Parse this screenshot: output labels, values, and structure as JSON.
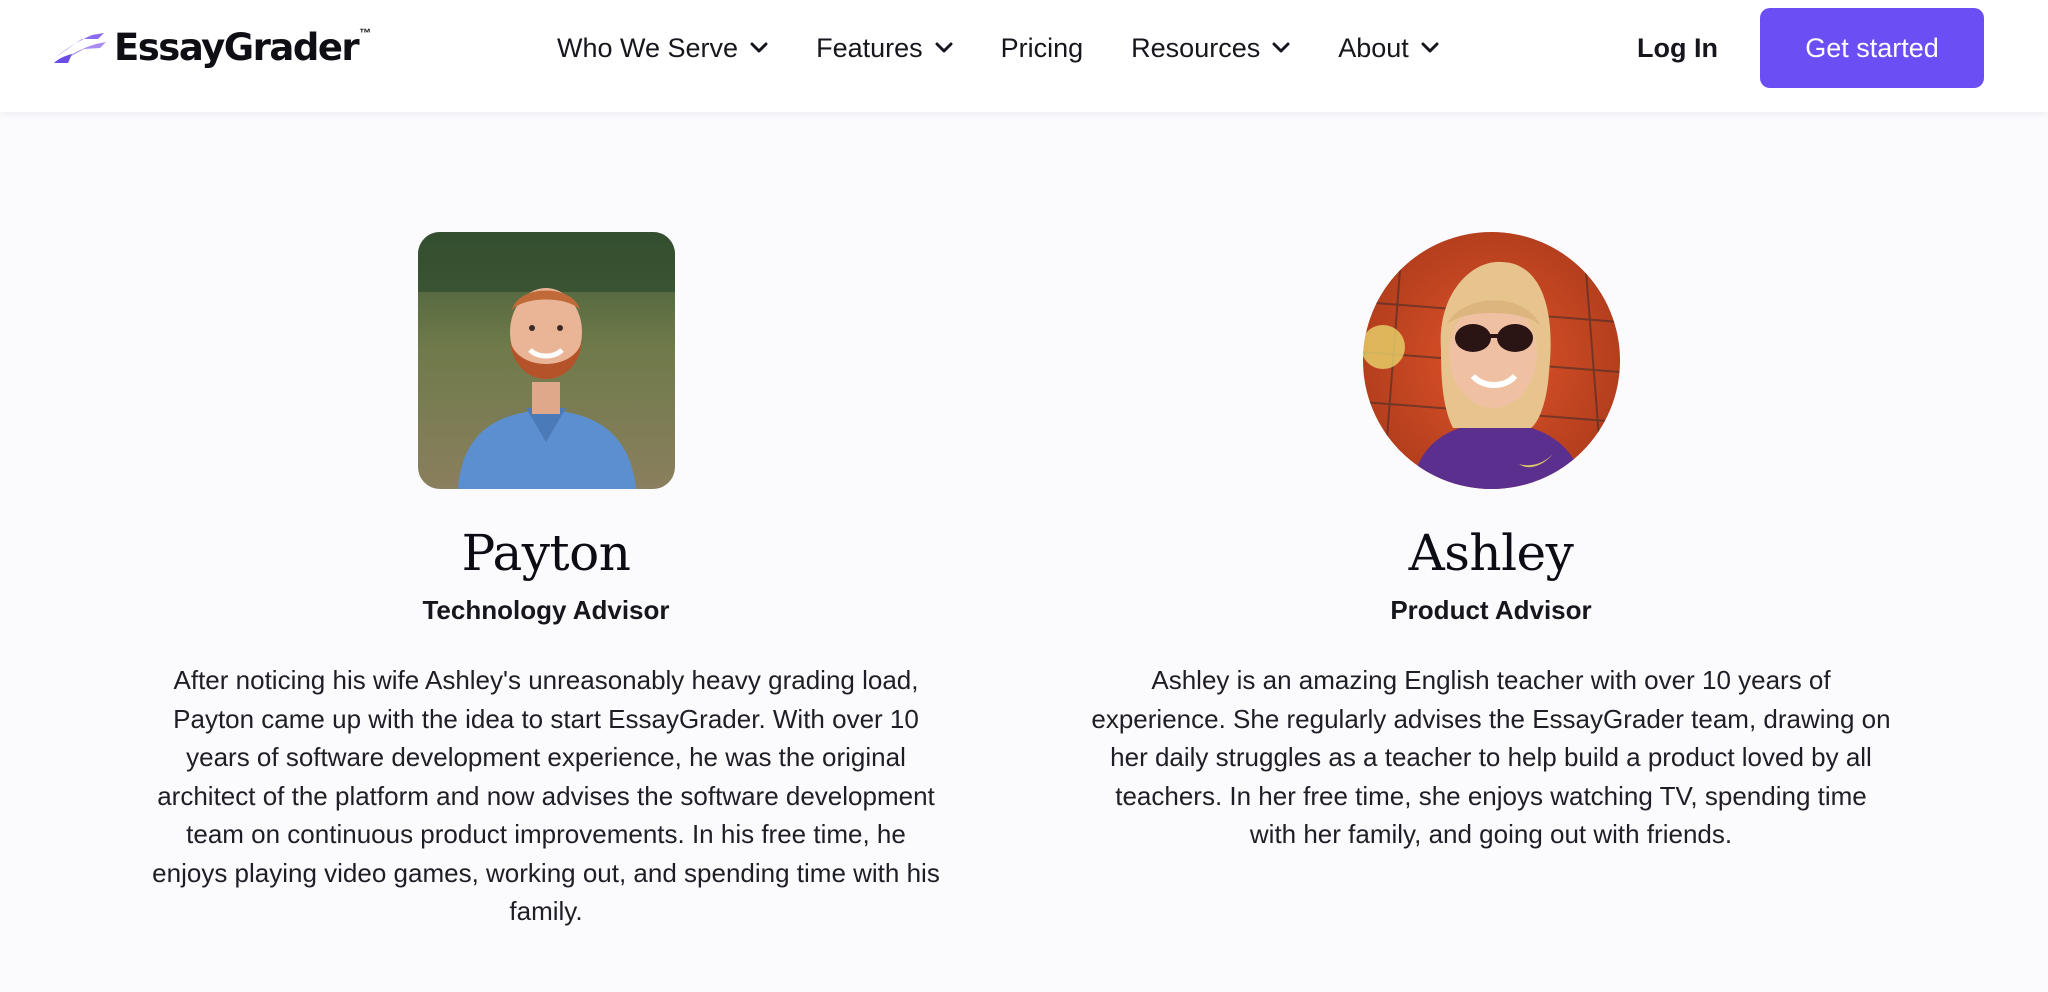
{
  "brand": {
    "name": "EssayGrader",
    "trademark": "™",
    "logo_icon": "purple-wing-icon",
    "accent_color": "#6c4ef5"
  },
  "nav": {
    "items": [
      {
        "label": "Who We Serve",
        "has_dropdown": true
      },
      {
        "label": "Features",
        "has_dropdown": true
      },
      {
        "label": "Pricing",
        "has_dropdown": false
      },
      {
        "label": "Resources",
        "has_dropdown": true
      },
      {
        "label": "About",
        "has_dropdown": true
      }
    ],
    "login_label": "Log In",
    "cta_label": "Get started"
  },
  "team": [
    {
      "name": "Payton",
      "role": "Technology Advisor",
      "photo_shape": "rounded-square",
      "bio": "After noticing his wife Ashley's unreasonably heavy grading load, Payton came up with the idea to start EssayGrader. With over 10 years of software development experience, he was the original architect of the platform and now advises the software development team on continuous product improvements. In his free time, he enjoys playing video games, working out, and spending time with his family."
    },
    {
      "name": "Ashley",
      "role": "Product Advisor",
      "photo_shape": "circle",
      "bio": "Ashley is an amazing English teacher with over 10 years of experience. She regularly advises the EssayGrader team, drawing on her daily struggles as a teacher to help build a product loved by all teachers. In her free time, she enjoys watching TV, spending time with her family, and going out with friends."
    }
  ]
}
